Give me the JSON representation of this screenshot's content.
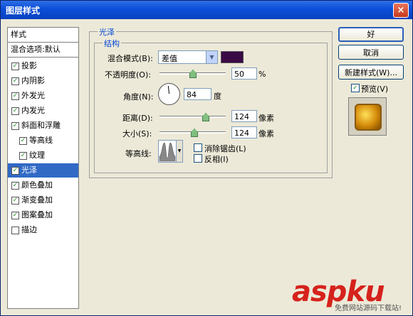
{
  "window": {
    "title": "图层样式",
    "close": "×"
  },
  "left_panel": {
    "header": "样式",
    "blend_options": "混合选项:默认",
    "items": [
      {
        "label": "投影",
        "checked": true
      },
      {
        "label": "内阴影",
        "checked": true
      },
      {
        "label": "外发光",
        "checked": true
      },
      {
        "label": "内发光",
        "checked": true
      },
      {
        "label": "斜面和浮雕",
        "checked": true
      },
      {
        "label": "等高线",
        "checked": true
      },
      {
        "label": "纹理",
        "checked": true
      },
      {
        "label": "光泽",
        "checked": true,
        "selected": true
      },
      {
        "label": "颜色叠加",
        "checked": true
      },
      {
        "label": "渐变叠加",
        "checked": true
      },
      {
        "label": "图案叠加",
        "checked": true
      },
      {
        "label": "描边",
        "checked": false
      }
    ]
  },
  "satin": {
    "group_title": "光泽",
    "structure_title": "结构",
    "blend_mode_label": "混合模式(B):",
    "blend_mode_value": "差值",
    "color": "#3a0a45",
    "opacity_label": "不透明度(O):",
    "opacity_value": "50",
    "opacity_unit": "%",
    "opacity_level": 0.5,
    "angle_label": "角度(N):",
    "angle_value": "84",
    "angle_unit": "度",
    "distance_label": "距离(D):",
    "distance_value": "124",
    "distance_unit": "像素",
    "size_label": "大小(S):",
    "size_value": "124",
    "size_unit": "像素",
    "contour_label": "等高线:",
    "antialias_label": "消除锯齿(L)",
    "invert_label": "反相(I)"
  },
  "buttons": {
    "ok": "好",
    "cancel": "取消",
    "new_style": "新建样式(W)...",
    "preview_label": "预览(V)",
    "preview_checked": true
  },
  "watermark": {
    "text": "aspku",
    "sub": "免费网站源码下载站!"
  }
}
